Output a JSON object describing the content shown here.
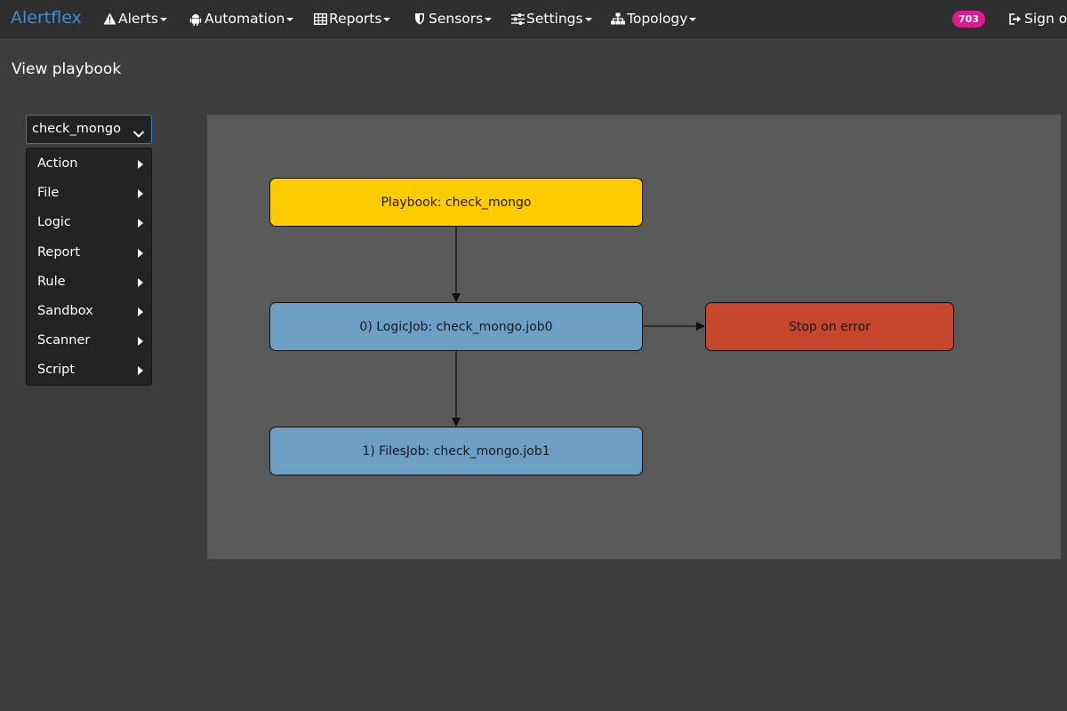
{
  "navbar": {
    "brand": "Alertflex",
    "items": [
      {
        "label": "Alerts",
        "icon": "warning-icon"
      },
      {
        "label": "Automation",
        "icon": "android-icon"
      },
      {
        "label": "Reports",
        "icon": "table-icon"
      },
      {
        "label": "Sensors",
        "icon": "shield-icon"
      },
      {
        "label": "Settings",
        "icon": "sliders-icon"
      },
      {
        "label": "Topology",
        "icon": "sitemap-icon"
      }
    ],
    "badge_count": "703",
    "sign_out": {
      "label": "Sign out",
      "icon": "sign-out-icon"
    }
  },
  "page": {
    "title": "View playbook"
  },
  "playbook_select": {
    "value": "check_mongo",
    "icon": "chevron-down-icon"
  },
  "job_menu": {
    "items": [
      {
        "label": "Action"
      },
      {
        "label": "File"
      },
      {
        "label": "Logic"
      },
      {
        "label": "Report"
      },
      {
        "label": "Rule"
      },
      {
        "label": "Sandbox"
      },
      {
        "label": "Scanner"
      },
      {
        "label": "Script"
      }
    ]
  },
  "diagram": {
    "colors": {
      "playbook": "#ffcc00",
      "job": "#6c9fc3",
      "error": "#c5462b",
      "canvas": "#595959"
    },
    "nodes": {
      "playbook": "Playbook: check_mongo",
      "job0": "0) LogicJob: check_mongo.job0",
      "job1": "1) FilesJob: check_mongo.job1",
      "stop": "Stop on error"
    }
  }
}
